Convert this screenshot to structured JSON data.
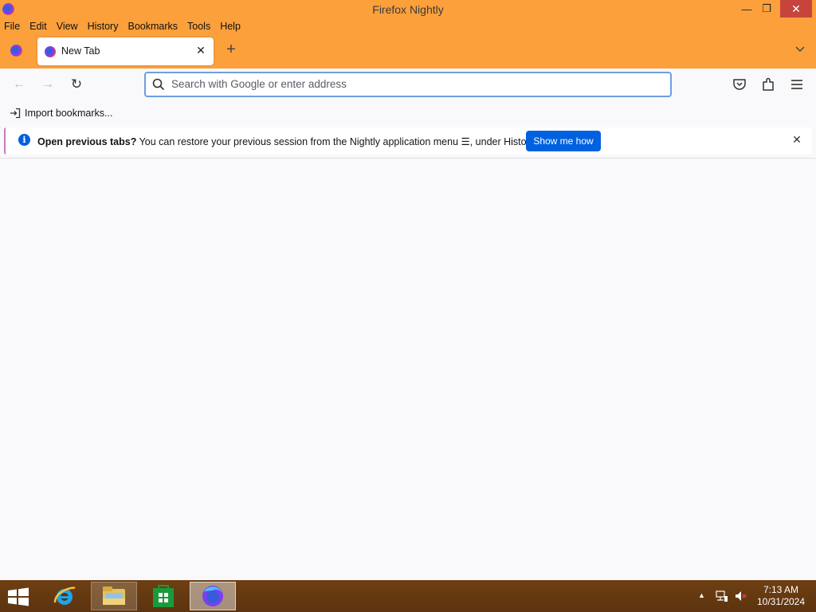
{
  "window": {
    "title": "Firefox Nightly",
    "minimize": "—",
    "maximize": "❐",
    "close": "✕"
  },
  "menubar": {
    "items": [
      "File",
      "Edit",
      "View",
      "History",
      "Bookmarks",
      "Tools",
      "Help"
    ]
  },
  "tabs": [
    {
      "title": "New Tab",
      "active": true
    }
  ],
  "tab_close_glyph": "✕",
  "new_tab_glyph": "+",
  "tab_list_glyph": "⌄",
  "nav": {
    "back_glyph": "←",
    "forward_glyph": "→",
    "reload_glyph": "↻",
    "address_placeholder": "Search with Google or enter address",
    "address_value": ""
  },
  "bookmarks_toolbar": {
    "import_label": "Import bookmarks..."
  },
  "notification": {
    "info_glyph": "i",
    "bold_text": "Open previous tabs?",
    "text": " You can restore your previous session from the Nightly application menu ☰, under History.",
    "button_label": "Show me how",
    "close_glyph": "✕"
  },
  "taskbar": {
    "apps": [
      "internet-explorer",
      "file-explorer",
      "store",
      "firefox-nightly"
    ],
    "tray_chevron": "▲",
    "time": "7:13 AM",
    "date": "10/31/2024"
  },
  "colors": {
    "frame": "#fca03c",
    "accent_button": "#0061e0",
    "close_red": "#c7443c",
    "taskbar": "#6e3f12"
  }
}
